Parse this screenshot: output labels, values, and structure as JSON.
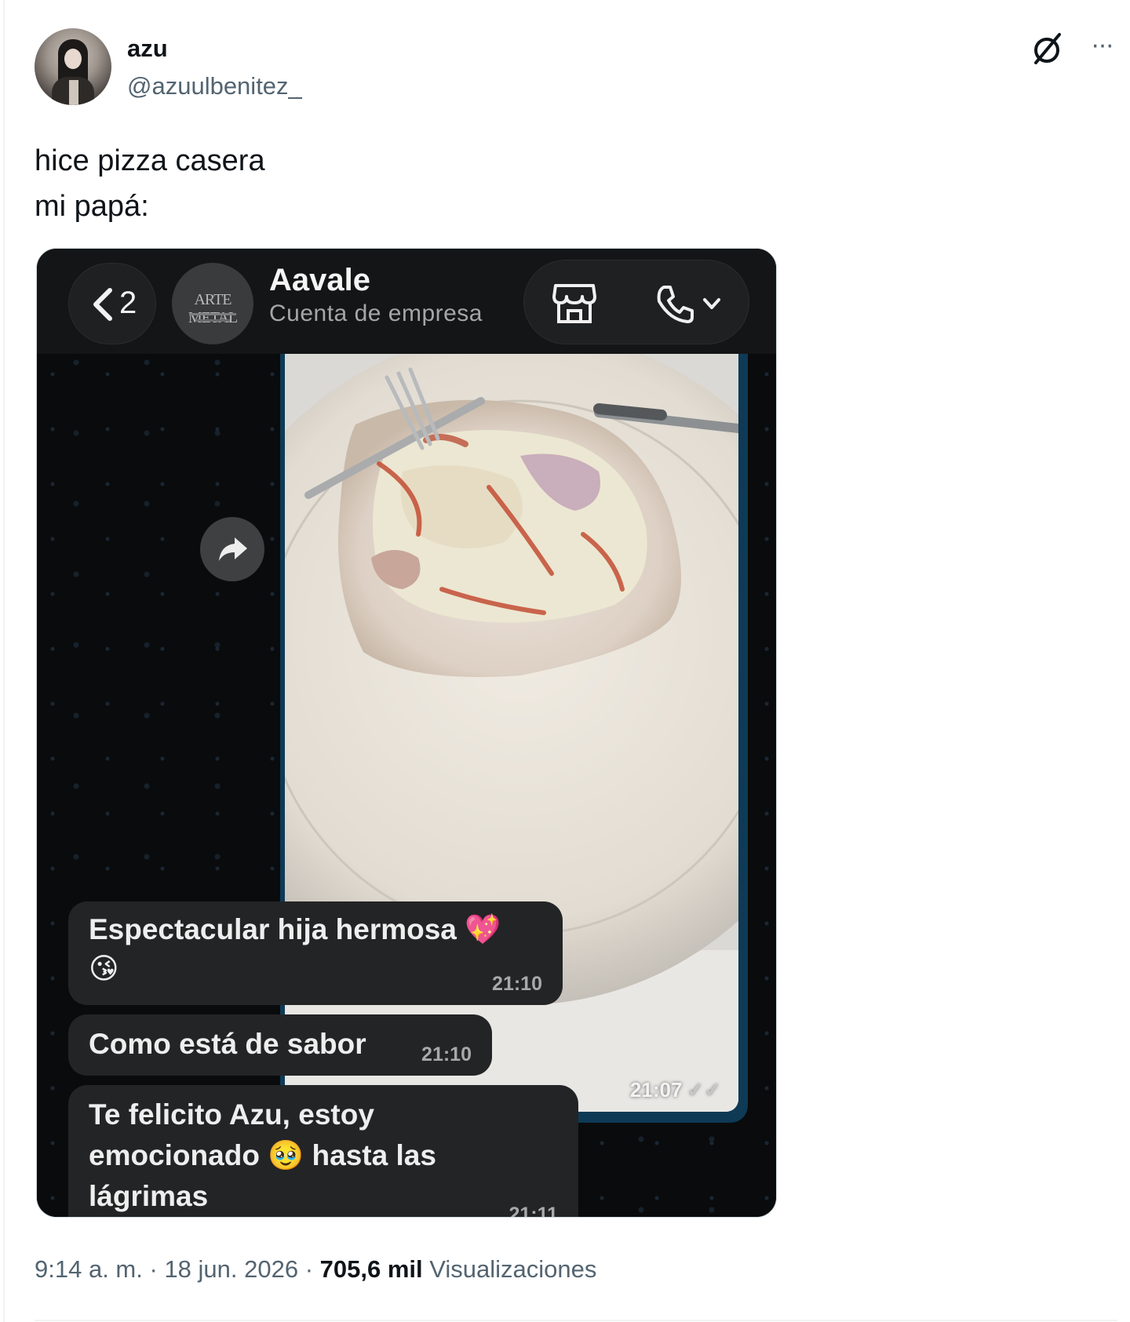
{
  "author": {
    "display_name": "azu",
    "handle": "@azuulbenitez_"
  },
  "tweet": {
    "lines": [
      "hice pizza casera",
      "mi papá:"
    ]
  },
  "chat": {
    "back_count": "2",
    "avatar_text": "ARTE METAL",
    "name": "Aavale",
    "subtitle": "Cuenta de empresa",
    "photo_time": "21:07",
    "messages": [
      {
        "lines": [
          "Espectacular hija hermosa 💖",
          "😘"
        ],
        "time": "21:10"
      },
      {
        "lines": [
          "Como está de sabor"
        ],
        "time": "21:10"
      },
      {
        "lines": [
          "Te felicito Azu, estoy",
          "emocionado 🥹 hasta las",
          "lágrimas"
        ],
        "time": "21:11"
      }
    ]
  },
  "meta": {
    "time": "9:14 a. m.",
    "date": "18 jun. 2026",
    "views_count": "705,6 mil",
    "views_label": "Visualizaciones",
    "separator": "·"
  },
  "icons": {
    "grok": "grok-icon",
    "more": "more-icon",
    "back": "chevron-left-icon",
    "store": "store-icon",
    "call": "phone-icon",
    "forward": "forward-icon"
  },
  "colors": {
    "text_primary": "#0f1419",
    "text_secondary": "#536471",
    "chat_bg": "#0a0b0c",
    "bubble": "#232425",
    "own_bubble": "#0e3a56"
  }
}
